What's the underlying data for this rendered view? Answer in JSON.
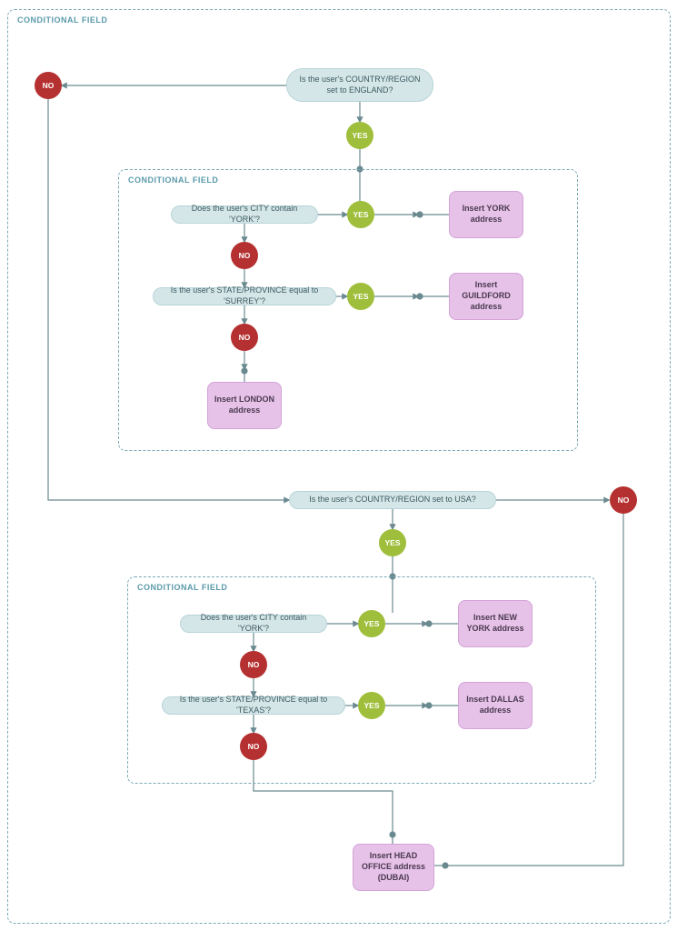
{
  "outerLabel": "CONDITIONAL FIELD",
  "england": {
    "q": "Is the user's COUNTRY/REGION set to ENGLAND?",
    "yes": "YES",
    "no": "NO",
    "inner": {
      "label": "CONDITIONAL FIELD",
      "q1": "Does the user's CITY contain 'YORK'?",
      "a1": "Insert YORK address",
      "q2": "Is the user's STATE/PROVINCE equal to 'SURREY'?",
      "a2": "Insert GUILDFORD address",
      "a3": "Insert LONDON address"
    }
  },
  "usa": {
    "q": "Is the user's COUNTRY/REGION set to USA?",
    "yes": "YES",
    "no": "NO",
    "inner": {
      "label": "CONDITIONAL FIELD",
      "q1": "Does the user's CITY contain 'YORK'?",
      "a1": "Insert NEW YORK address",
      "q2": "Is the user's STATE/PROVINCE equal to 'TEXAS'?",
      "a2": "Insert DALLAS address"
    }
  },
  "fallback": "Insert HEAD OFFICE address (DUBAI)",
  "chart_data": {
    "type": "flowchart",
    "root": {
      "condition": "COUNTRY/REGION == ENGLAND",
      "yes": {
        "condition": "CITY contains 'YORK'",
        "yes": {
          "action": "Insert YORK address"
        },
        "no": {
          "condition": "STATE/PROVINCE == 'SURREY'",
          "yes": {
            "action": "Insert GUILDFORD address"
          },
          "no": {
            "action": "Insert LONDON address"
          }
        }
      },
      "no": {
        "condition": "COUNTRY/REGION == USA",
        "yes": {
          "condition": "CITY contains 'YORK'",
          "yes": {
            "action": "Insert NEW YORK address"
          },
          "no": {
            "condition": "STATE/PROVINCE == 'TEXAS'",
            "yes": {
              "action": "Insert DALLAS address"
            },
            "no": {
              "action": "Insert HEAD OFFICE address (DUBAI)"
            }
          }
        },
        "no": {
          "action": "Insert HEAD OFFICE address (DUBAI)"
        }
      }
    }
  }
}
